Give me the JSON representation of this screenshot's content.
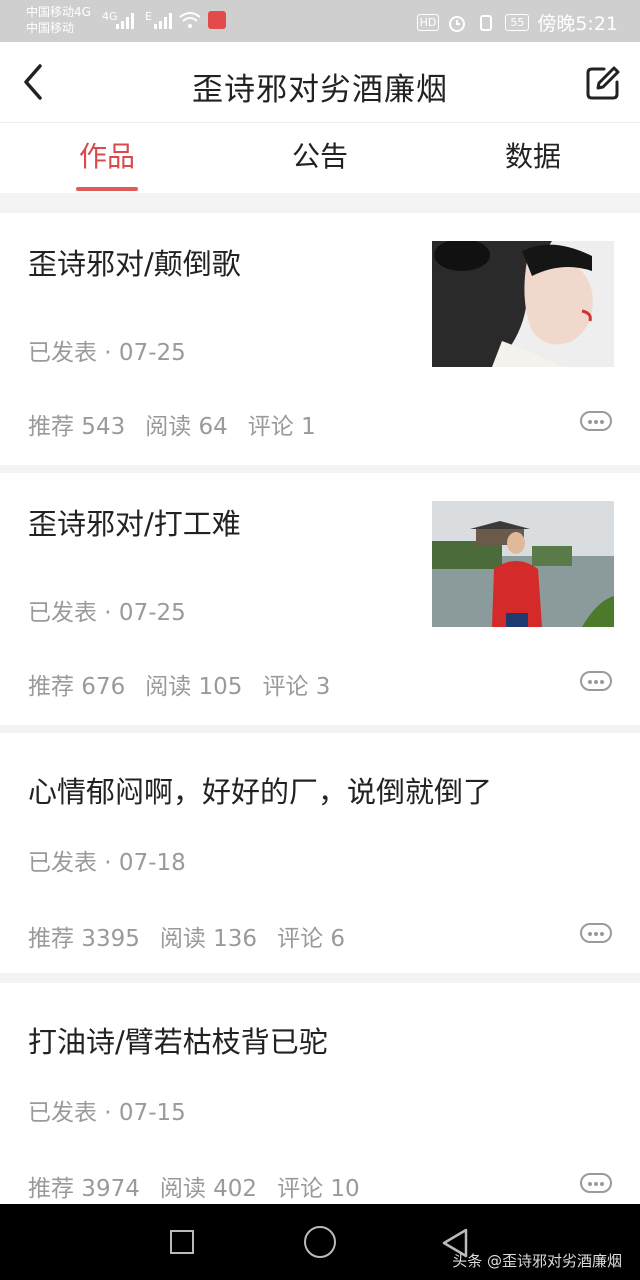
{
  "status": {
    "carrier1": "中国移动4G",
    "carrier2": "中国移动",
    "net1": "4G",
    "net2": "E",
    "hd": "HD",
    "battery": "55",
    "time": "傍晚5:21"
  },
  "header": {
    "title": "歪诗邪对劣酒廉烟"
  },
  "tabs": [
    {
      "label": "作品",
      "active": true
    },
    {
      "label": "公告"
    },
    {
      "label": "数据"
    }
  ],
  "posts": [
    {
      "title": "歪诗邪对/颠倒歌",
      "date": "已发表 · 07-25",
      "recommend": "推荐 543",
      "read": "阅读 64",
      "comment": "评论 1",
      "thumb": "woman-portrait"
    },
    {
      "title": "歪诗邪对/打工难",
      "date": "已发表 · 07-25",
      "recommend": "推荐 676",
      "read": "阅读 105",
      "comment": "评论 3",
      "thumb": "man-lakeside"
    },
    {
      "title": "心情郁闷啊，好好的厂，说倒就倒了",
      "date": "已发表 · 07-18",
      "recommend": "推荐 3395",
      "read": "阅读 136",
      "comment": "评论 6"
    },
    {
      "title": "打油诗/臂若枯枝背已驼",
      "date": "已发表 · 07-15",
      "recommend": "推荐 3974",
      "read": "阅读 402",
      "comment": "评论 10"
    }
  ],
  "watermark": "头条 @歪诗邪对劣酒廉烟",
  "colors": {
    "accent": "#d94a4a",
    "meta": "#9a9a9a"
  }
}
